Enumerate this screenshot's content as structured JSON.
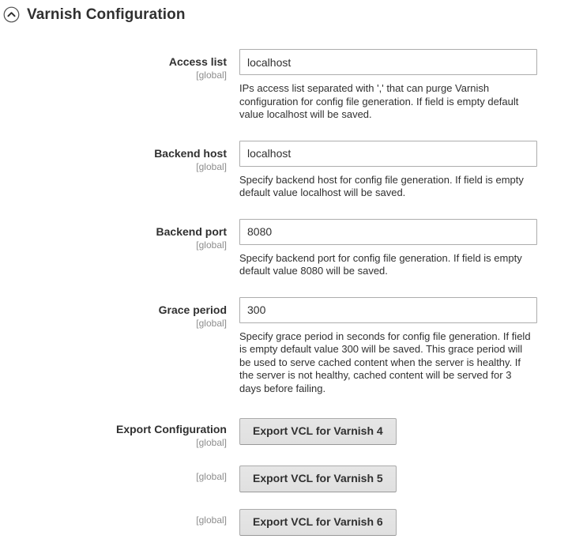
{
  "section": {
    "title": "Varnish Configuration",
    "collapse_icon": "chevron-up-circle-icon",
    "expanded": true
  },
  "scope_label": "[global]",
  "fields": [
    {
      "label": "Access list",
      "scope": "[global]",
      "value": "localhost",
      "placeholder": "",
      "note": "IPs access list separated with ',' that can purge Varnish configuration for config file generation. If field is empty default value localhost will be saved."
    },
    {
      "label": "Backend host",
      "scope": "[global]",
      "value": "localhost",
      "placeholder": "",
      "note": "Specify backend host for config file generation. If field is empty default value localhost will be saved."
    },
    {
      "label": "Backend port",
      "scope": "[global]",
      "value": "8080",
      "placeholder": "",
      "note": "Specify backend port for config file generation. If field is empty default value 8080 will be saved."
    },
    {
      "label": "Grace period",
      "scope": "[global]",
      "value": "300",
      "placeholder": "",
      "note": "Specify grace period in seconds for config file generation. If field is empty default value 300 will be saved. This grace period will be used to serve cached content when the server is healthy. If the server is not healthy, cached content will be served for 3 days before failing."
    }
  ],
  "export": {
    "label": "Export Configuration",
    "buttons": [
      {
        "scope": "[global]",
        "label": "Export VCL for Varnish 4"
      },
      {
        "scope": "[global]",
        "label": "Export VCL for Varnish 5"
      },
      {
        "scope": "[global]",
        "label": "Export VCL for Varnish 6"
      }
    ]
  },
  "colors": {
    "text": "#303030",
    "muted": "#8d8d8d",
    "input_border": "#adadad",
    "button_bg": "#e3e3e3",
    "button_border": "#ababab",
    "background": "#ffffff"
  }
}
